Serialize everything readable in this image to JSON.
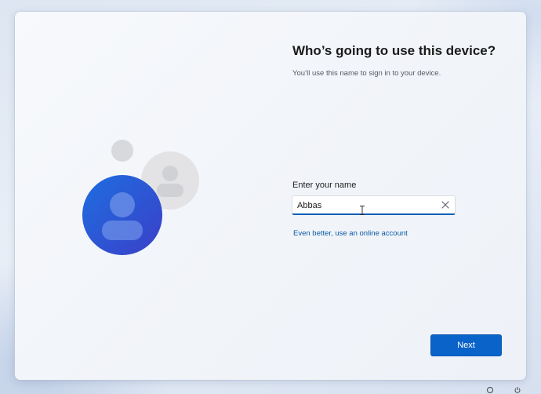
{
  "setup": {
    "title": "Who’s going to use this device?",
    "subtitle": "You’ll use this name to sign in to your device.",
    "name_label": "Enter your name",
    "name_value": "Abbas",
    "clear_icon": "close-icon",
    "online_account_link": "Even better, use an online account",
    "next_label": "Next"
  },
  "illustration": {
    "icon": "people-icon",
    "primary_color": "#1f5fd6",
    "secondary_color": "#d7d8db"
  },
  "colors": {
    "accent": "#0a63c9",
    "link": "#0b5aa5",
    "input_underline": "#0a5fb4"
  },
  "taskbar": {
    "icons": [
      "accessibility-icon",
      "power-icon"
    ]
  }
}
